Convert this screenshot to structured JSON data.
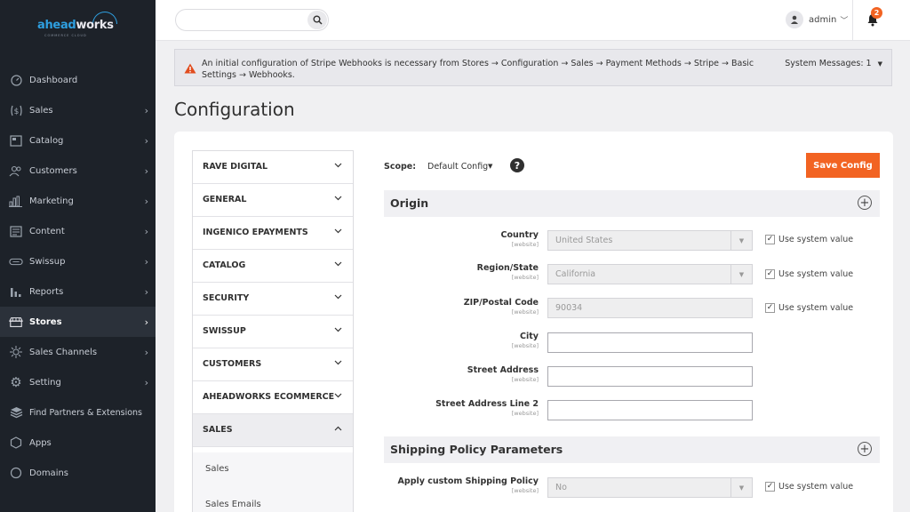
{
  "brand": {
    "name_part1": "ahead",
    "name_part2": "works",
    "tagline": "COMMERCE CLOUD"
  },
  "sidebar": {
    "items": [
      {
        "label": "Dashboard",
        "icon": "dashboard-icon",
        "chevron": false
      },
      {
        "label": "Sales",
        "icon": "dollar-icon",
        "chevron": true
      },
      {
        "label": "Catalog",
        "icon": "catalog-icon",
        "chevron": true
      },
      {
        "label": "Customers",
        "icon": "customers-icon",
        "chevron": true
      },
      {
        "label": "Marketing",
        "icon": "marketing-icon",
        "chevron": true
      },
      {
        "label": "Content",
        "icon": "content-icon",
        "chevron": true
      },
      {
        "label": "Swissup",
        "icon": "swissup-icon",
        "chevron": true
      },
      {
        "label": "Reports",
        "icon": "reports-icon",
        "chevron": true
      },
      {
        "label": "Stores",
        "icon": "stores-icon",
        "chevron": true,
        "active": true
      },
      {
        "label": "Sales Channels",
        "icon": "sales-channels-icon",
        "chevron": true
      },
      {
        "label": "Setting",
        "icon": "gear-icon",
        "chevron": true
      },
      {
        "label": "Find Partners & Extensions",
        "icon": "extensions-icon",
        "chevron": false
      },
      {
        "label": "Apps",
        "icon": "apps-icon",
        "chevron": false
      },
      {
        "label": "Domains",
        "icon": "domains-icon",
        "chevron": false
      }
    ]
  },
  "header": {
    "search_value": "",
    "user_name": "admin",
    "notification_count": "2"
  },
  "message": {
    "text": "An initial configuration of Stripe Webhooks is necessary from Stores → Configuration → Sales → Payment Methods → Stripe → Basic Settings → Webhooks.",
    "system_messages": "System Messages: 1"
  },
  "page": {
    "title": "Configuration"
  },
  "config_tabs": [
    {
      "label": "RAVE DIGITAL",
      "open": false
    },
    {
      "label": "GENERAL",
      "open": false
    },
    {
      "label": "INGENICO EPAYMENTS",
      "open": false
    },
    {
      "label": "CATALOG",
      "open": false
    },
    {
      "label": "SECURITY",
      "open": false
    },
    {
      "label": "SWISSUP",
      "open": false
    },
    {
      "label": "CUSTOMERS",
      "open": false
    },
    {
      "label": "AHEADWORKS ECOMMERCE",
      "open": false
    },
    {
      "label": "SALES",
      "open": true
    }
  ],
  "sub_tabs": [
    "Sales",
    "Sales Emails"
  ],
  "scope": {
    "label": "Scope:",
    "value": "Default Config"
  },
  "save_button": "Save Config",
  "sections": {
    "origin": {
      "title": "Origin",
      "fields": [
        {
          "label": "Country",
          "scope": "[website]",
          "type": "select",
          "value": "United States",
          "use_system": "Use system value"
        },
        {
          "label": "Region/State",
          "scope": "[website]",
          "type": "select",
          "value": "California",
          "use_system": "Use system value"
        },
        {
          "label": "ZIP/Postal Code",
          "scope": "[website]",
          "type": "text-disabled",
          "value": "90034",
          "use_system": "Use system value"
        },
        {
          "label": "City",
          "scope": "[website]",
          "type": "text",
          "value": ""
        },
        {
          "label": "Street Address",
          "scope": "[website]",
          "type": "text",
          "value": ""
        },
        {
          "label": "Street Address Line 2",
          "scope": "[website]",
          "type": "text",
          "value": ""
        }
      ]
    },
    "shipping_policy": {
      "title": "Shipping Policy Parameters",
      "fields": [
        {
          "label": "Apply custom Shipping Policy",
          "scope": "[website]",
          "type": "select",
          "value": "No",
          "use_system": "Use system value"
        }
      ]
    }
  },
  "colors": {
    "accent": "#f26322",
    "sidebar_bg": "#1d2229",
    "brand_blue": "#2e9fe0"
  }
}
